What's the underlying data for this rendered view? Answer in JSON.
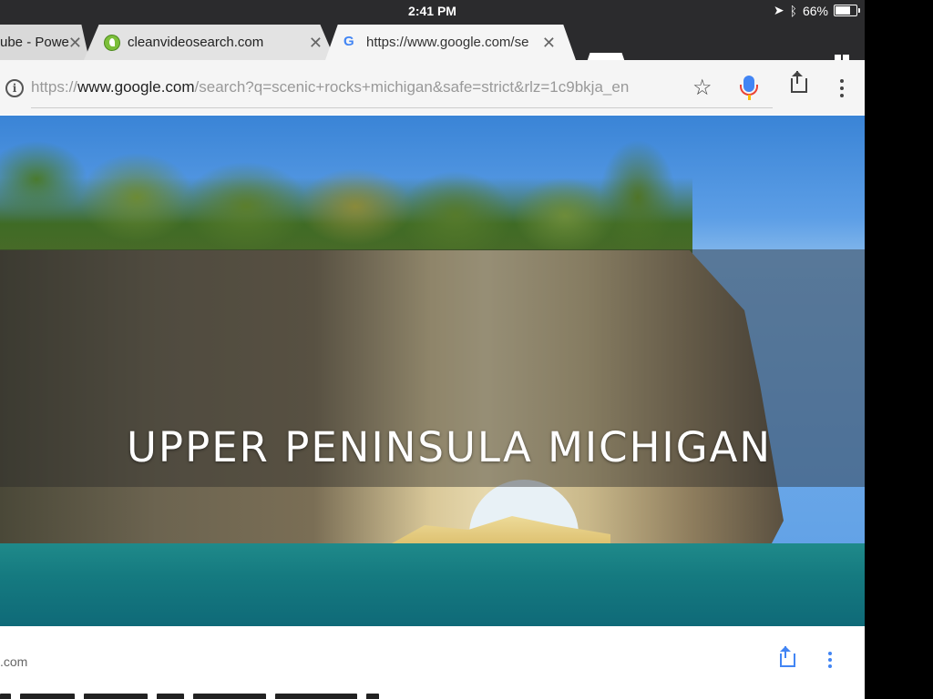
{
  "status_bar": {
    "time": "2:41 PM",
    "battery": "66%"
  },
  "tabs": [
    {
      "label": "ube - Powe",
      "close": "✕"
    },
    {
      "label": "cleanvideosearch.com",
      "close": "✕"
    },
    {
      "label": "https://www.google.com/se",
      "close": "✕"
    }
  ],
  "omnibox": {
    "scheme": "https://",
    "host": "www.google.com",
    "path": "/search?q=scenic+rocks+michigan&safe=strict&rlz=1c9bkja_en"
  },
  "hero": {
    "headline": "UPPER PENINSULA MICHIGAN"
  },
  "result": {
    "domain": ".com"
  },
  "icons": {
    "location": "location-arrow-icon",
    "bluetooth": "bluetooth-icon",
    "battery": "battery-icon",
    "tab_switcher": "tab-switcher-icon",
    "info": "info-icon",
    "bookmark": "star-icon",
    "voice": "microphone-icon",
    "share": "share-icon",
    "menu": "more-vert-icon"
  },
  "colors": {
    "google_blue": "#4285f4",
    "chrome_dark": "#2b2b2d"
  }
}
